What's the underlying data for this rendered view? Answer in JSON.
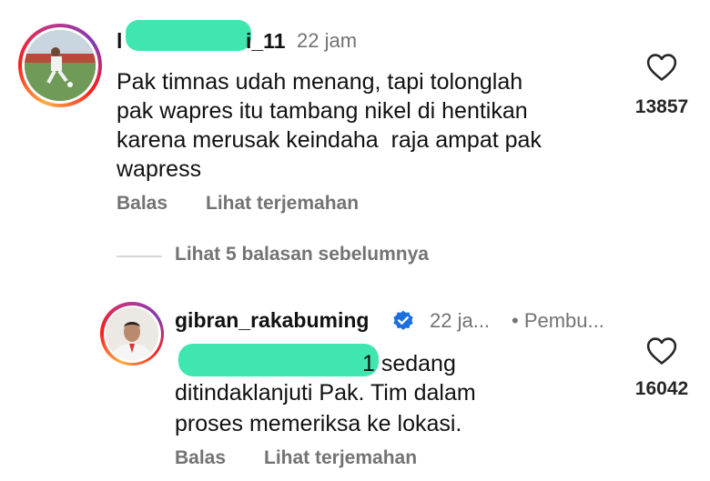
{
  "comment1": {
    "username_prefix": "l",
    "username_suffix": "i_11",
    "time": "22 jam",
    "text_lines": [
      "Pak timnas udah menang, tapi tolonglah",
      "pak wapres itu tambang nikel di hentikan",
      "karena merusak keindaha  raja ampat pak",
      "wapress"
    ],
    "reply_label": "Balas",
    "translate_label": "Lihat terjemahan",
    "like_count": "13857"
  },
  "view_replies_label": "Lihat 5 balasan sebelumnya",
  "reply": {
    "username": "gibran_rakabuming",
    "time": "22 ja...",
    "creator_label": "• Pembu...",
    "text_line1_suffix": "1 sedang",
    "text_line2": "ditindaklanjuti Pak. Tim dalam",
    "text_line3": "proses memeriksa ke lokasi.",
    "reply_label": "Balas",
    "translate_label": "Lihat terjemahan",
    "like_count": "16042"
  },
  "colors": {
    "redaction": "#3fe6b0",
    "verified": "#1d6fe0",
    "secondary_text": "#737373"
  }
}
